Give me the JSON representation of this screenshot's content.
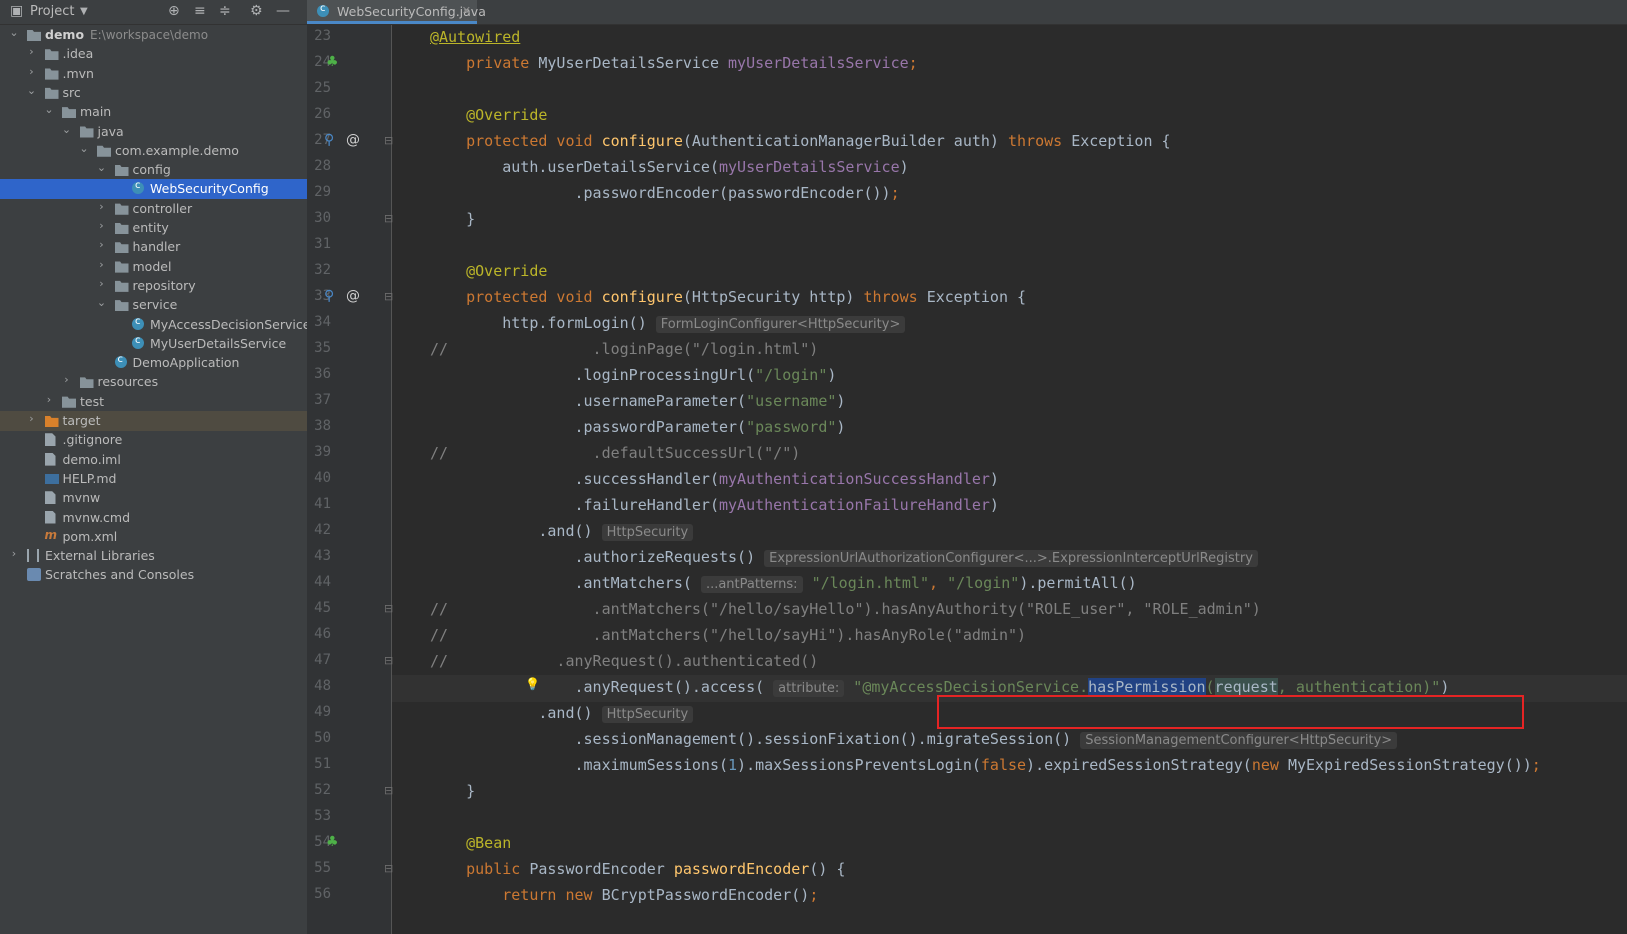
{
  "project": {
    "header_title": "Project",
    "root_name": "demo",
    "root_path": "E:\\workspace\\demo",
    "tree": [
      {
        "label": ".idea",
        "indent": 1,
        "arrow": "right",
        "icon": "folder"
      },
      {
        "label": ".mvn",
        "indent": 1,
        "arrow": "right",
        "icon": "folder"
      },
      {
        "label": "src",
        "indent": 1,
        "arrow": "down",
        "icon": "folder"
      },
      {
        "label": "main",
        "indent": 2,
        "arrow": "down",
        "icon": "folder"
      },
      {
        "label": "java",
        "indent": 3,
        "arrow": "down",
        "icon": "folder"
      },
      {
        "label": "com.example.demo",
        "indent": 4,
        "arrow": "down",
        "icon": "folder"
      },
      {
        "label": "config",
        "indent": 5,
        "arrow": "down",
        "icon": "folder"
      },
      {
        "label": "WebSecurityConfig",
        "indent": 6,
        "arrow": "",
        "icon": "class",
        "selected": true
      },
      {
        "label": "controller",
        "indent": 5,
        "arrow": "right",
        "icon": "folder"
      },
      {
        "label": "entity",
        "indent": 5,
        "arrow": "right",
        "icon": "folder"
      },
      {
        "label": "handler",
        "indent": 5,
        "arrow": "right",
        "icon": "folder"
      },
      {
        "label": "model",
        "indent": 5,
        "arrow": "right",
        "icon": "folder"
      },
      {
        "label": "repository",
        "indent": 5,
        "arrow": "right",
        "icon": "folder"
      },
      {
        "label": "service",
        "indent": 5,
        "arrow": "down",
        "icon": "folder"
      },
      {
        "label": "MyAccessDecisionService",
        "indent": 6,
        "arrow": "",
        "icon": "class"
      },
      {
        "label": "MyUserDetailsService",
        "indent": 6,
        "arrow": "",
        "icon": "class"
      },
      {
        "label": "DemoApplication",
        "indent": 5,
        "arrow": "",
        "icon": "class"
      },
      {
        "label": "resources",
        "indent": 3,
        "arrow": "right",
        "icon": "folder"
      },
      {
        "label": "test",
        "indent": 2,
        "arrow": "right",
        "icon": "folder"
      },
      {
        "label": "target",
        "indent": 1,
        "arrow": "right",
        "icon": "folder-orange",
        "excluded": true
      },
      {
        "label": ".gitignore",
        "indent": 1,
        "arrow": "",
        "icon": "file"
      },
      {
        "label": "demo.iml",
        "indent": 1,
        "arrow": "",
        "icon": "file"
      },
      {
        "label": "HELP.md",
        "indent": 1,
        "arrow": "",
        "icon": "md"
      },
      {
        "label": "mvnw",
        "indent": 1,
        "arrow": "",
        "icon": "file"
      },
      {
        "label": "mvnw.cmd",
        "indent": 1,
        "arrow": "",
        "icon": "file"
      },
      {
        "label": "pom.xml",
        "indent": 1,
        "arrow": "",
        "icon": "maven"
      },
      {
        "label": "External Libraries",
        "indent": 0,
        "arrow": "right",
        "icon": "lib"
      },
      {
        "label": "Scratches and Consoles",
        "indent": 0,
        "arrow": "",
        "icon": "scratch"
      }
    ]
  },
  "editor": {
    "tab_label": "WebSecurityConfig.java",
    "lines": [
      {
        "n": "23",
        "t": [
          [
            "ann",
            "@Autowired"
          ]
        ]
      },
      {
        "n": "24",
        "t": [
          [
            "kw",
            "    private "
          ],
          [
            "",
            "MyUserDetailsService "
          ],
          [
            "fld",
            "myUserDetailsService"
          ],
          [
            "kw",
            ";"
          ]
        ]
      },
      {
        "n": "25",
        "t": []
      },
      {
        "n": "26",
        "t": [
          [
            "ann",
            "    @Override"
          ]
        ]
      },
      {
        "n": "27",
        "t": [
          [
            "kw",
            "    protected void "
          ],
          [
            "fn",
            "configure"
          ],
          [
            "",
            "(AuthenticationManagerBuilder auth) "
          ],
          [
            "kw",
            "throws "
          ],
          [
            "",
            "Exception {"
          ]
        ]
      },
      {
        "n": "28",
        "t": [
          [
            "",
            "        auth.userDetailsService("
          ],
          [
            "fld",
            "myUserDetailsService"
          ],
          [
            "",
            ")"
          ]
        ]
      },
      {
        "n": "29",
        "t": [
          [
            "",
            "                .passwordEncoder(passwordEncoder())"
          ],
          [
            "kw",
            ";"
          ]
        ]
      },
      {
        "n": "30",
        "t": [
          [
            "",
            "    }"
          ]
        ]
      },
      {
        "n": "31",
        "t": []
      },
      {
        "n": "32",
        "t": [
          [
            "ann",
            "    @Override"
          ]
        ]
      },
      {
        "n": "33",
        "t": [
          [
            "kw",
            "    protected void "
          ],
          [
            "fn",
            "configure"
          ],
          [
            "",
            "(HttpSecurity http) "
          ],
          [
            "kw",
            "throws "
          ],
          [
            "",
            "Exception {"
          ]
        ]
      },
      {
        "n": "34",
        "t": [
          [
            "",
            "        http.formLogin() "
          ],
          [
            "hint",
            "FormLoginConfigurer<HttpSecurity>"
          ]
        ]
      },
      {
        "n": "35",
        "t": [
          [
            "cmt",
            "//                .loginPage(\"/login.html\")"
          ]
        ]
      },
      {
        "n": "36",
        "t": [
          [
            "",
            "                .loginProcessingUrl("
          ],
          [
            "str",
            "\"/login\""
          ],
          [
            "",
            ")"
          ]
        ]
      },
      {
        "n": "37",
        "t": [
          [
            "",
            "                .usernameParameter("
          ],
          [
            "str",
            "\"username\""
          ],
          [
            "",
            ")"
          ]
        ]
      },
      {
        "n": "38",
        "t": [
          [
            "",
            "                .passwordParameter("
          ],
          [
            "str",
            "\"password\""
          ],
          [
            "",
            ")"
          ]
        ]
      },
      {
        "n": "39",
        "t": [
          [
            "cmt",
            "//                .defaultSuccessUrl(\"/\")"
          ]
        ]
      },
      {
        "n": "40",
        "t": [
          [
            "",
            "                .successHandler("
          ],
          [
            "fld",
            "myAuthenticationSuccessHandler"
          ],
          [
            "",
            ")"
          ]
        ]
      },
      {
        "n": "41",
        "t": [
          [
            "",
            "                .failureHandler("
          ],
          [
            "fld",
            "myAuthenticationFailureHandler"
          ],
          [
            "",
            ")"
          ]
        ]
      },
      {
        "n": "42",
        "t": [
          [
            "",
            "            .and() "
          ],
          [
            "hint",
            "HttpSecurity"
          ]
        ]
      },
      {
        "n": "43",
        "t": [
          [
            "",
            "                .authorizeRequests() "
          ],
          [
            "hint",
            "ExpressionUrlAuthorizationConfigurer<...>.ExpressionInterceptUrlRegistry"
          ]
        ]
      },
      {
        "n": "44",
        "t": [
          [
            "",
            "                .antMatchers( "
          ],
          [
            "hint",
            "...antPatterns:"
          ],
          [
            "str",
            " \"/login.html\""
          ],
          [
            "kw",
            ", "
          ],
          [
            "str",
            "\"/login\""
          ],
          [
            "",
            ").permitAll()"
          ]
        ]
      },
      {
        "n": "45",
        "t": [
          [
            "cmt",
            "//                .antMatchers(\"/hello/sayHello\").hasAnyAuthority(\"ROLE_user\", \"ROLE_admin\")"
          ]
        ]
      },
      {
        "n": "46",
        "t": [
          [
            "cmt",
            "//                .antMatchers(\"/hello/sayHi\").hasAnyRole(\"admin\")"
          ]
        ]
      },
      {
        "n": "47",
        "t": [
          [
            "cmt",
            "//            .anyRequest().authenticated()"
          ]
        ]
      },
      {
        "n": "48",
        "t": [
          [
            "",
            "                .anyRequest().access( "
          ],
          [
            "hint",
            "attribute:"
          ],
          [
            "str",
            " \"@myAccessDecisionService."
          ],
          [
            "sel",
            "hasPermission"
          ],
          [
            "str",
            "("
          ],
          [
            "par",
            "request"
          ],
          [
            "str",
            ", authentication)\""
          ],
          [
            "",
            ")"
          ]
        ]
      },
      {
        "n": "49",
        "t": [
          [
            "",
            "            .and() "
          ],
          [
            "hint",
            "HttpSecurity"
          ]
        ]
      },
      {
        "n": "50",
        "t": [
          [
            "",
            "                .sessionManagement().sessionFixation().migrateSession() "
          ],
          [
            "hint",
            "SessionManagementConfigurer<HttpSecurity>"
          ]
        ]
      },
      {
        "n": "51",
        "t": [
          [
            "",
            "                .maximumSessions("
          ],
          [
            "num",
            "1"
          ],
          [
            "",
            ").maxSessionsPreventsLogin("
          ],
          [
            "kw",
            "false"
          ],
          [
            "",
            ").expiredSessionStrategy("
          ],
          [
            "kw",
            "new "
          ],
          [
            "",
            "MyExpiredSessionStrategy())"
          ],
          [
            "kw",
            ";"
          ]
        ]
      },
      {
        "n": "52",
        "t": [
          [
            "",
            "    }"
          ]
        ]
      },
      {
        "n": "53",
        "t": []
      },
      {
        "n": "54",
        "t": [
          [
            "ann",
            "    @Bean"
          ]
        ]
      },
      {
        "n": "55",
        "t": [
          [
            "kw",
            "    public "
          ],
          [
            "",
            "PasswordEncoder "
          ],
          [
            "fn",
            "passwordEncoder"
          ],
          [
            "",
            "() {"
          ]
        ]
      },
      {
        "n": "56",
        "t": [
          [
            "kw",
            "        return new "
          ],
          [
            "",
            "BCryptPasswordEncoder()"
          ],
          [
            "kw",
            ";"
          ]
        ]
      }
    ]
  }
}
